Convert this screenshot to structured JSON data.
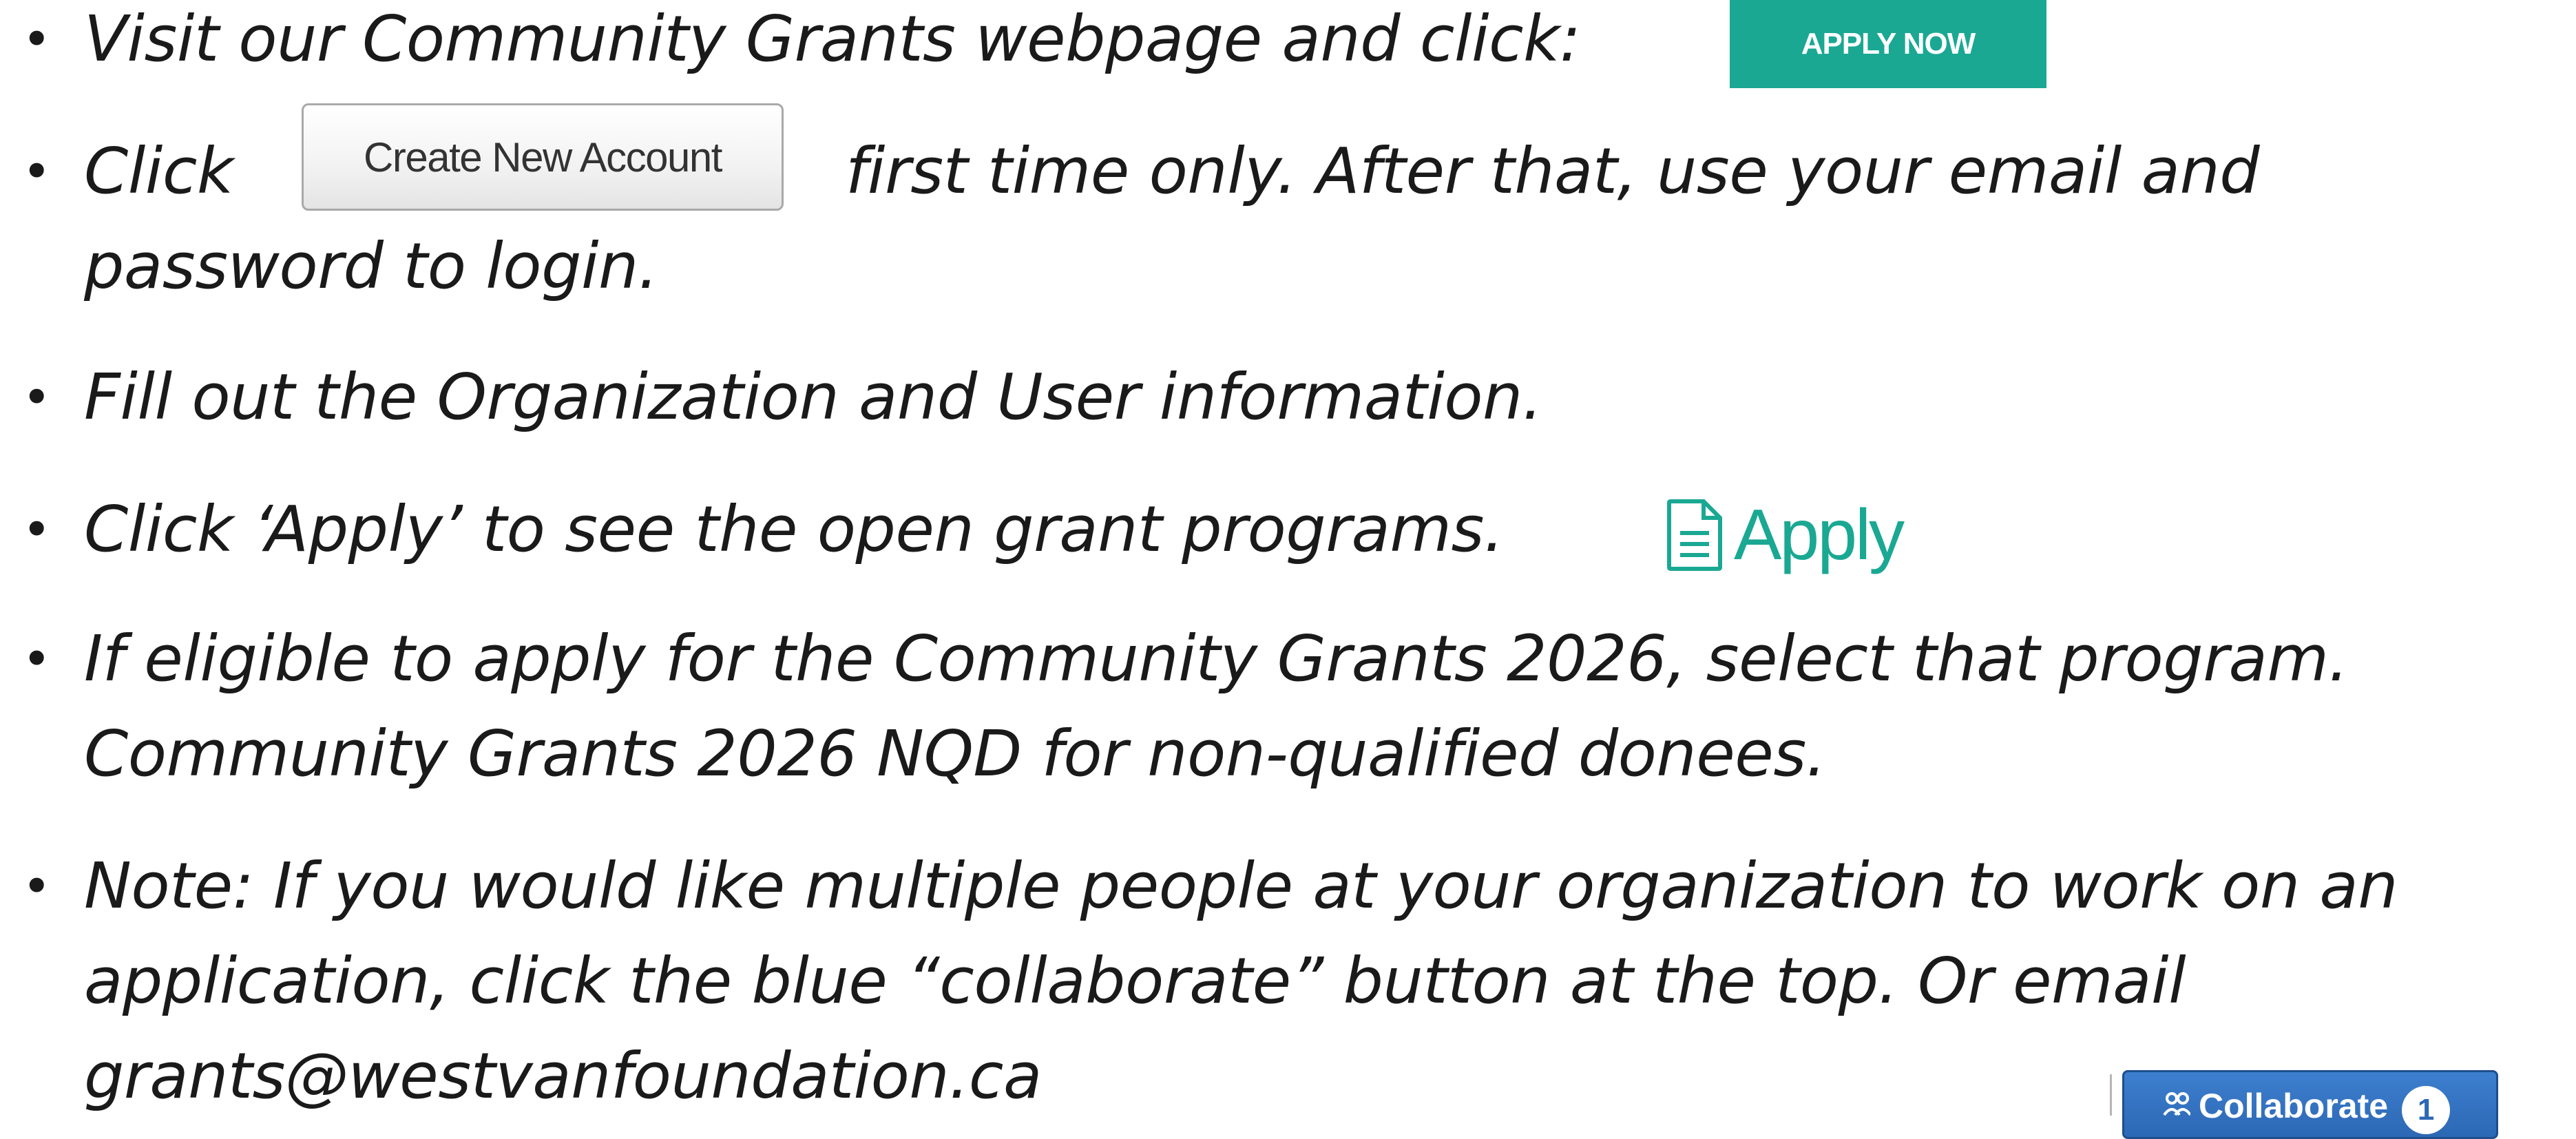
{
  "steps": [
    {
      "lines": [
        "Visit our Community Grants webpage and click:"
      ]
    },
    {
      "lines": [
        "Click",
        "first time only. After that, use your email and",
        "password to login."
      ]
    },
    {
      "lines": [
        "Fill out the Organization and User information."
      ]
    },
    {
      "lines": [
        "Click ‘Apply’ to see the open grant programs."
      ]
    },
    {
      "lines": [
        "If eligible to apply for the Community Grants 2026, select that program.",
        "Community Grants 2026 NQD for non-qualified donees."
      ]
    },
    {
      "lines": [
        "Note: If you would like multiple people at your organization to work on an",
        "application, click the blue “collaborate” button at the top.  Or email",
        "grants@westvanfoundation.ca"
      ]
    }
  ],
  "bullet_char": "•",
  "buttons": {
    "apply_now": "APPLY NOW",
    "create_new_account": "Create New Account",
    "apply": "Apply",
    "collaborate": "Collaborate",
    "collaborate_badge": "1"
  },
  "colors": {
    "teal_accent": "#1aa893",
    "collaborate_blue": "#2c68b4",
    "text": "#1a1a1a"
  },
  "icons": {
    "apply_icon": "document-icon",
    "collaborate_icon": "users-icon"
  }
}
